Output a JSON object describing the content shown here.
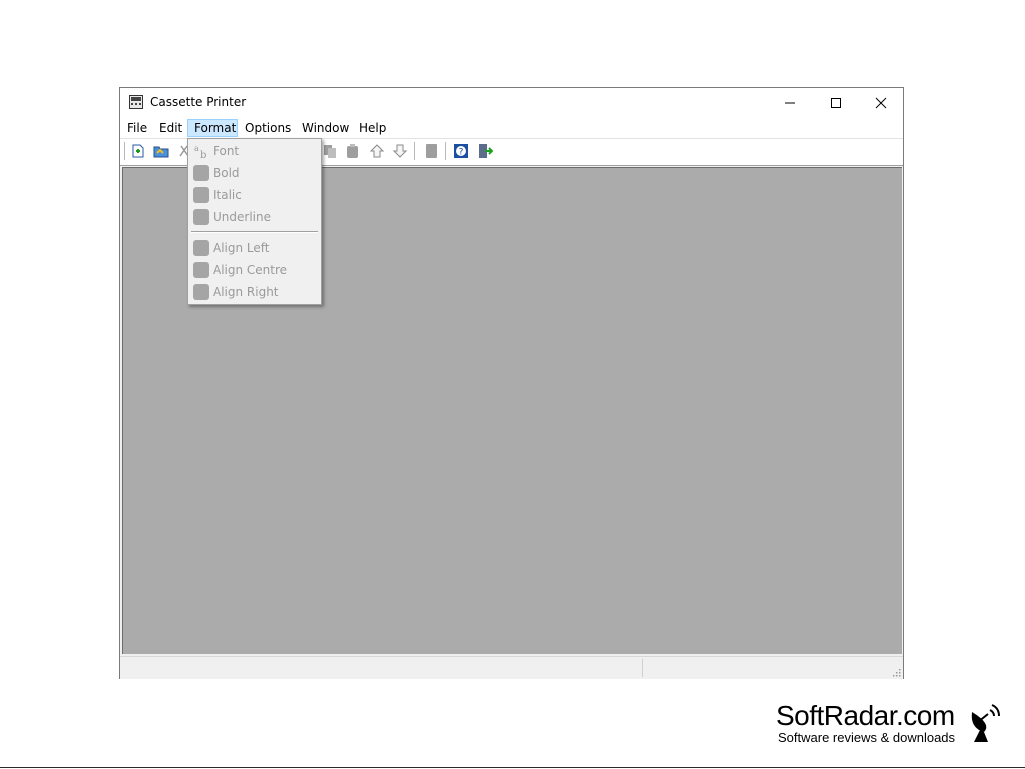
{
  "window": {
    "title": "Cassette Printer",
    "controls": {
      "minimize": "minimize-icon",
      "maximize": "maximize-icon",
      "close": "close-icon"
    }
  },
  "menubar": {
    "items": [
      {
        "label": "File"
      },
      {
        "label": "Edit"
      },
      {
        "label": "Format",
        "active": true
      },
      {
        "label": "Options"
      },
      {
        "label": "Window"
      },
      {
        "label": "Help"
      }
    ]
  },
  "toolbar": {
    "buttons": [
      "new-document-icon",
      "open-folder-icon",
      "cut-icon",
      "copy-icon",
      "paste-icon",
      "move-up-icon",
      "move-down-icon",
      "page-icon",
      "help-icon",
      "exit-icon"
    ]
  },
  "format_menu": {
    "items": [
      {
        "label": "Font",
        "enabled": false
      },
      {
        "label": "Bold",
        "enabled": false
      },
      {
        "label": "Italic",
        "enabled": false
      },
      {
        "label": "Underline",
        "enabled": false
      },
      {
        "label": "Align Left",
        "enabled": false
      },
      {
        "label": "Align Centre",
        "enabled": false
      },
      {
        "label": "Align Right",
        "enabled": false
      }
    ]
  },
  "watermark": {
    "name": "SoftRadar.com",
    "tagline": "Software reviews & downloads"
  },
  "colors": {
    "workspace": "#ababab",
    "menu_active": "#cce8ff",
    "disabled_text": "#9a9a9a"
  }
}
